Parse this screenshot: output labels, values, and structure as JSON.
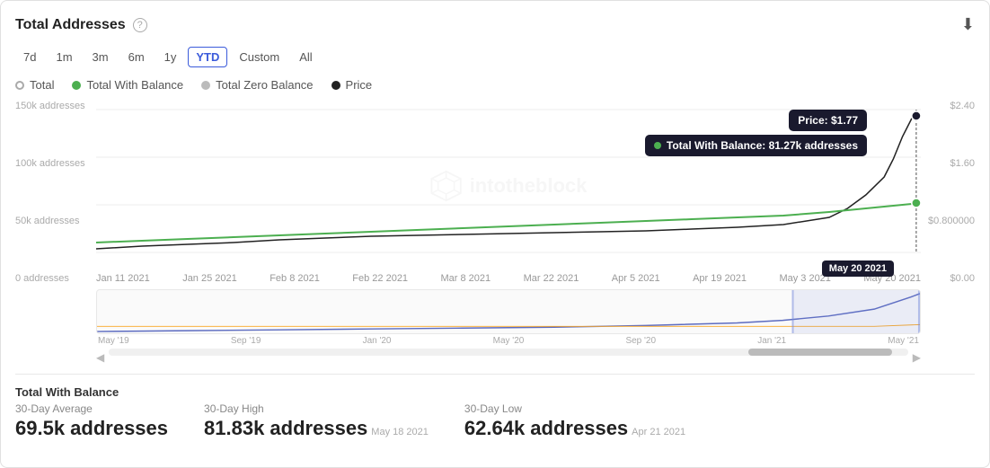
{
  "card": {
    "title": "Total Addresses",
    "download_label": "⬇"
  },
  "time_filters": {
    "buttons": [
      "7d",
      "1m",
      "3m",
      "6m",
      "1y",
      "YTD",
      "Custom",
      "All"
    ],
    "active": "YTD"
  },
  "legend": {
    "items": [
      {
        "label": "Total",
        "color": "#aaaaaa",
        "dotStyle": "hollow"
      },
      {
        "label": "Total With Balance",
        "color": "#4caf50"
      },
      {
        "label": "Total Zero Balance",
        "color": "#bbbbbb"
      },
      {
        "label": "Price",
        "color": "#222222"
      }
    ]
  },
  "y_axis_left": [
    "150k addresses",
    "100k addresses",
    "50k addresses",
    "0 addresses"
  ],
  "y_axis_right": [
    "$2.40",
    "$1.60",
    "$0.800000",
    "$0.00"
  ],
  "x_axis_labels": [
    "Jan 11 2021",
    "Jan 25 2021",
    "Feb 8 2021",
    "Feb 22 2021",
    "Mar 8 2021",
    "Mar 22 2021",
    "Apr 5 2021",
    "Apr 19 2021",
    "May 3 2021",
    "May 20 2021"
  ],
  "mini_labels": [
    "May '19",
    "Sep '19",
    "Jan '20",
    "May '20",
    "Sep '20",
    "Jan '21",
    "May '21"
  ],
  "tooltips": {
    "price": "Price: $1.77",
    "balance": "Total With Balance: 81.27k addresses",
    "date": "May 20 2021"
  },
  "stats": {
    "section_title": "Total With Balance",
    "items": [
      {
        "label": "30-Day Average",
        "value": "69.5k addresses",
        "date": ""
      },
      {
        "label": "30-Day High",
        "value": "81.83k addresses",
        "date": "May 18 2021"
      },
      {
        "label": "30-Day Low",
        "value": "62.64k addresses",
        "date": "Apr 21 2021"
      }
    ]
  },
  "watermark": "intotheblock"
}
